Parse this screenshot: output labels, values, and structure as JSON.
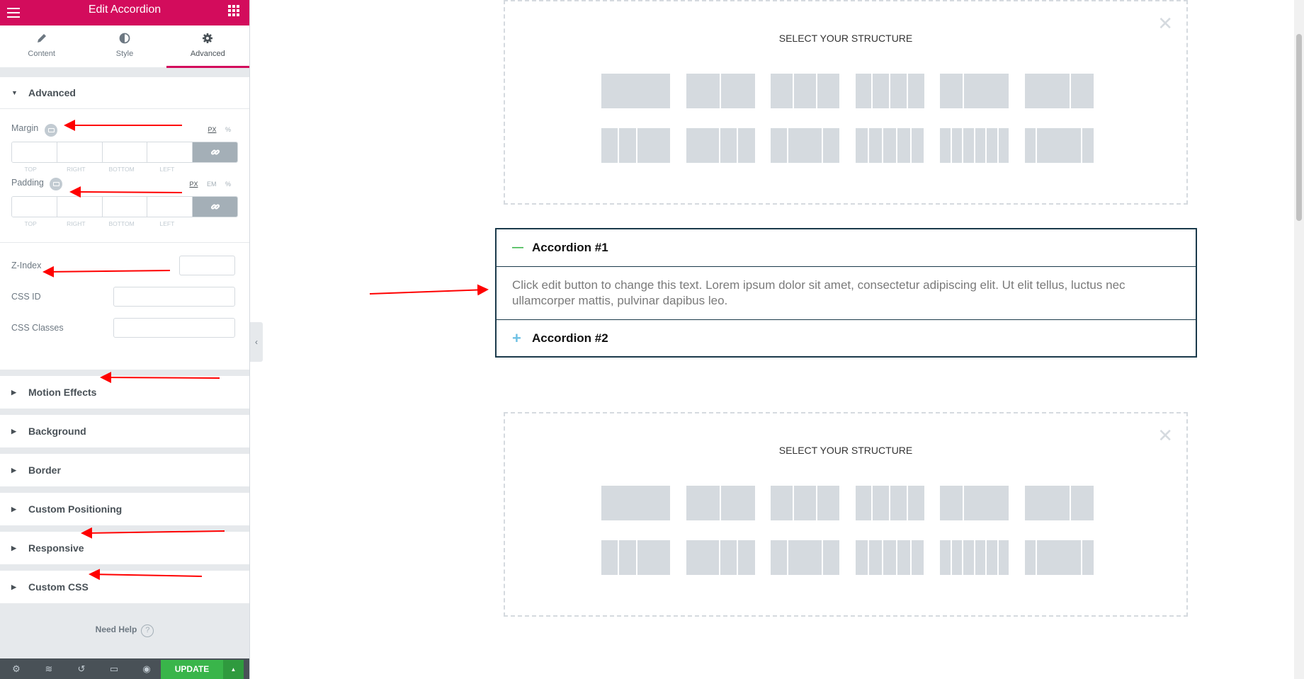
{
  "panel": {
    "title": "Edit Accordion",
    "tabs": [
      {
        "label": "Content",
        "icon": "pencil-icon"
      },
      {
        "label": "Style",
        "icon": "half-circle-icon"
      },
      {
        "label": "Advanced",
        "icon": "gear-icon"
      }
    ],
    "active_tab": "Advanced",
    "advanced_section": {
      "title": "Advanced",
      "margin": {
        "label": "Margin",
        "units": [
          "PX",
          "%"
        ],
        "active_unit": "PX",
        "sides": [
          "TOP",
          "RIGHT",
          "BOTTOM",
          "LEFT"
        ]
      },
      "padding": {
        "label": "Padding",
        "units": [
          "PX",
          "EM",
          "%"
        ],
        "active_unit": "PX",
        "sides": [
          "TOP",
          "RIGHT",
          "BOTTOM",
          "LEFT"
        ]
      },
      "z_index": {
        "label": "Z-Index",
        "value": ""
      },
      "css_id": {
        "label": "CSS ID",
        "value": ""
      },
      "css_classes": {
        "label": "CSS Classes",
        "value": ""
      }
    },
    "sections": [
      "Motion Effects",
      "Background",
      "Border",
      "Custom Positioning",
      "Responsive",
      "Custom CSS"
    ],
    "need_help": "Need Help",
    "help_icon": "?",
    "footer": {
      "update_label": "UPDATE",
      "icons": [
        "settings-icon",
        "layers-icon",
        "history-icon",
        "responsive-icon",
        "preview-icon"
      ]
    }
  },
  "canvas": {
    "structure_heading": "SELECT YOUR STRUCTURE",
    "close_glyph": "✕",
    "accordion": {
      "items": [
        {
          "title": "Accordion #1",
          "expanded": true,
          "icon": "minus-icon",
          "content": "Click edit button to change this text. Lorem ipsum dolor sit amet, consectetur adipiscing elit. Ut elit tellus, luctus nec ullamcorper mattis, pulvinar dapibus leo."
        },
        {
          "title": "Accordion #2",
          "expanded": false,
          "icon": "plus-icon"
        }
      ],
      "minus_glyph": "—",
      "plus_glyph": "+",
      "border_color": "#1b3a4b",
      "minus_color": "#39b54a",
      "plus_color": "#6ec1e4"
    }
  },
  "colors": {
    "brand": "#d30c5c",
    "update": "#39b54a",
    "annotation": "#ff0000"
  }
}
